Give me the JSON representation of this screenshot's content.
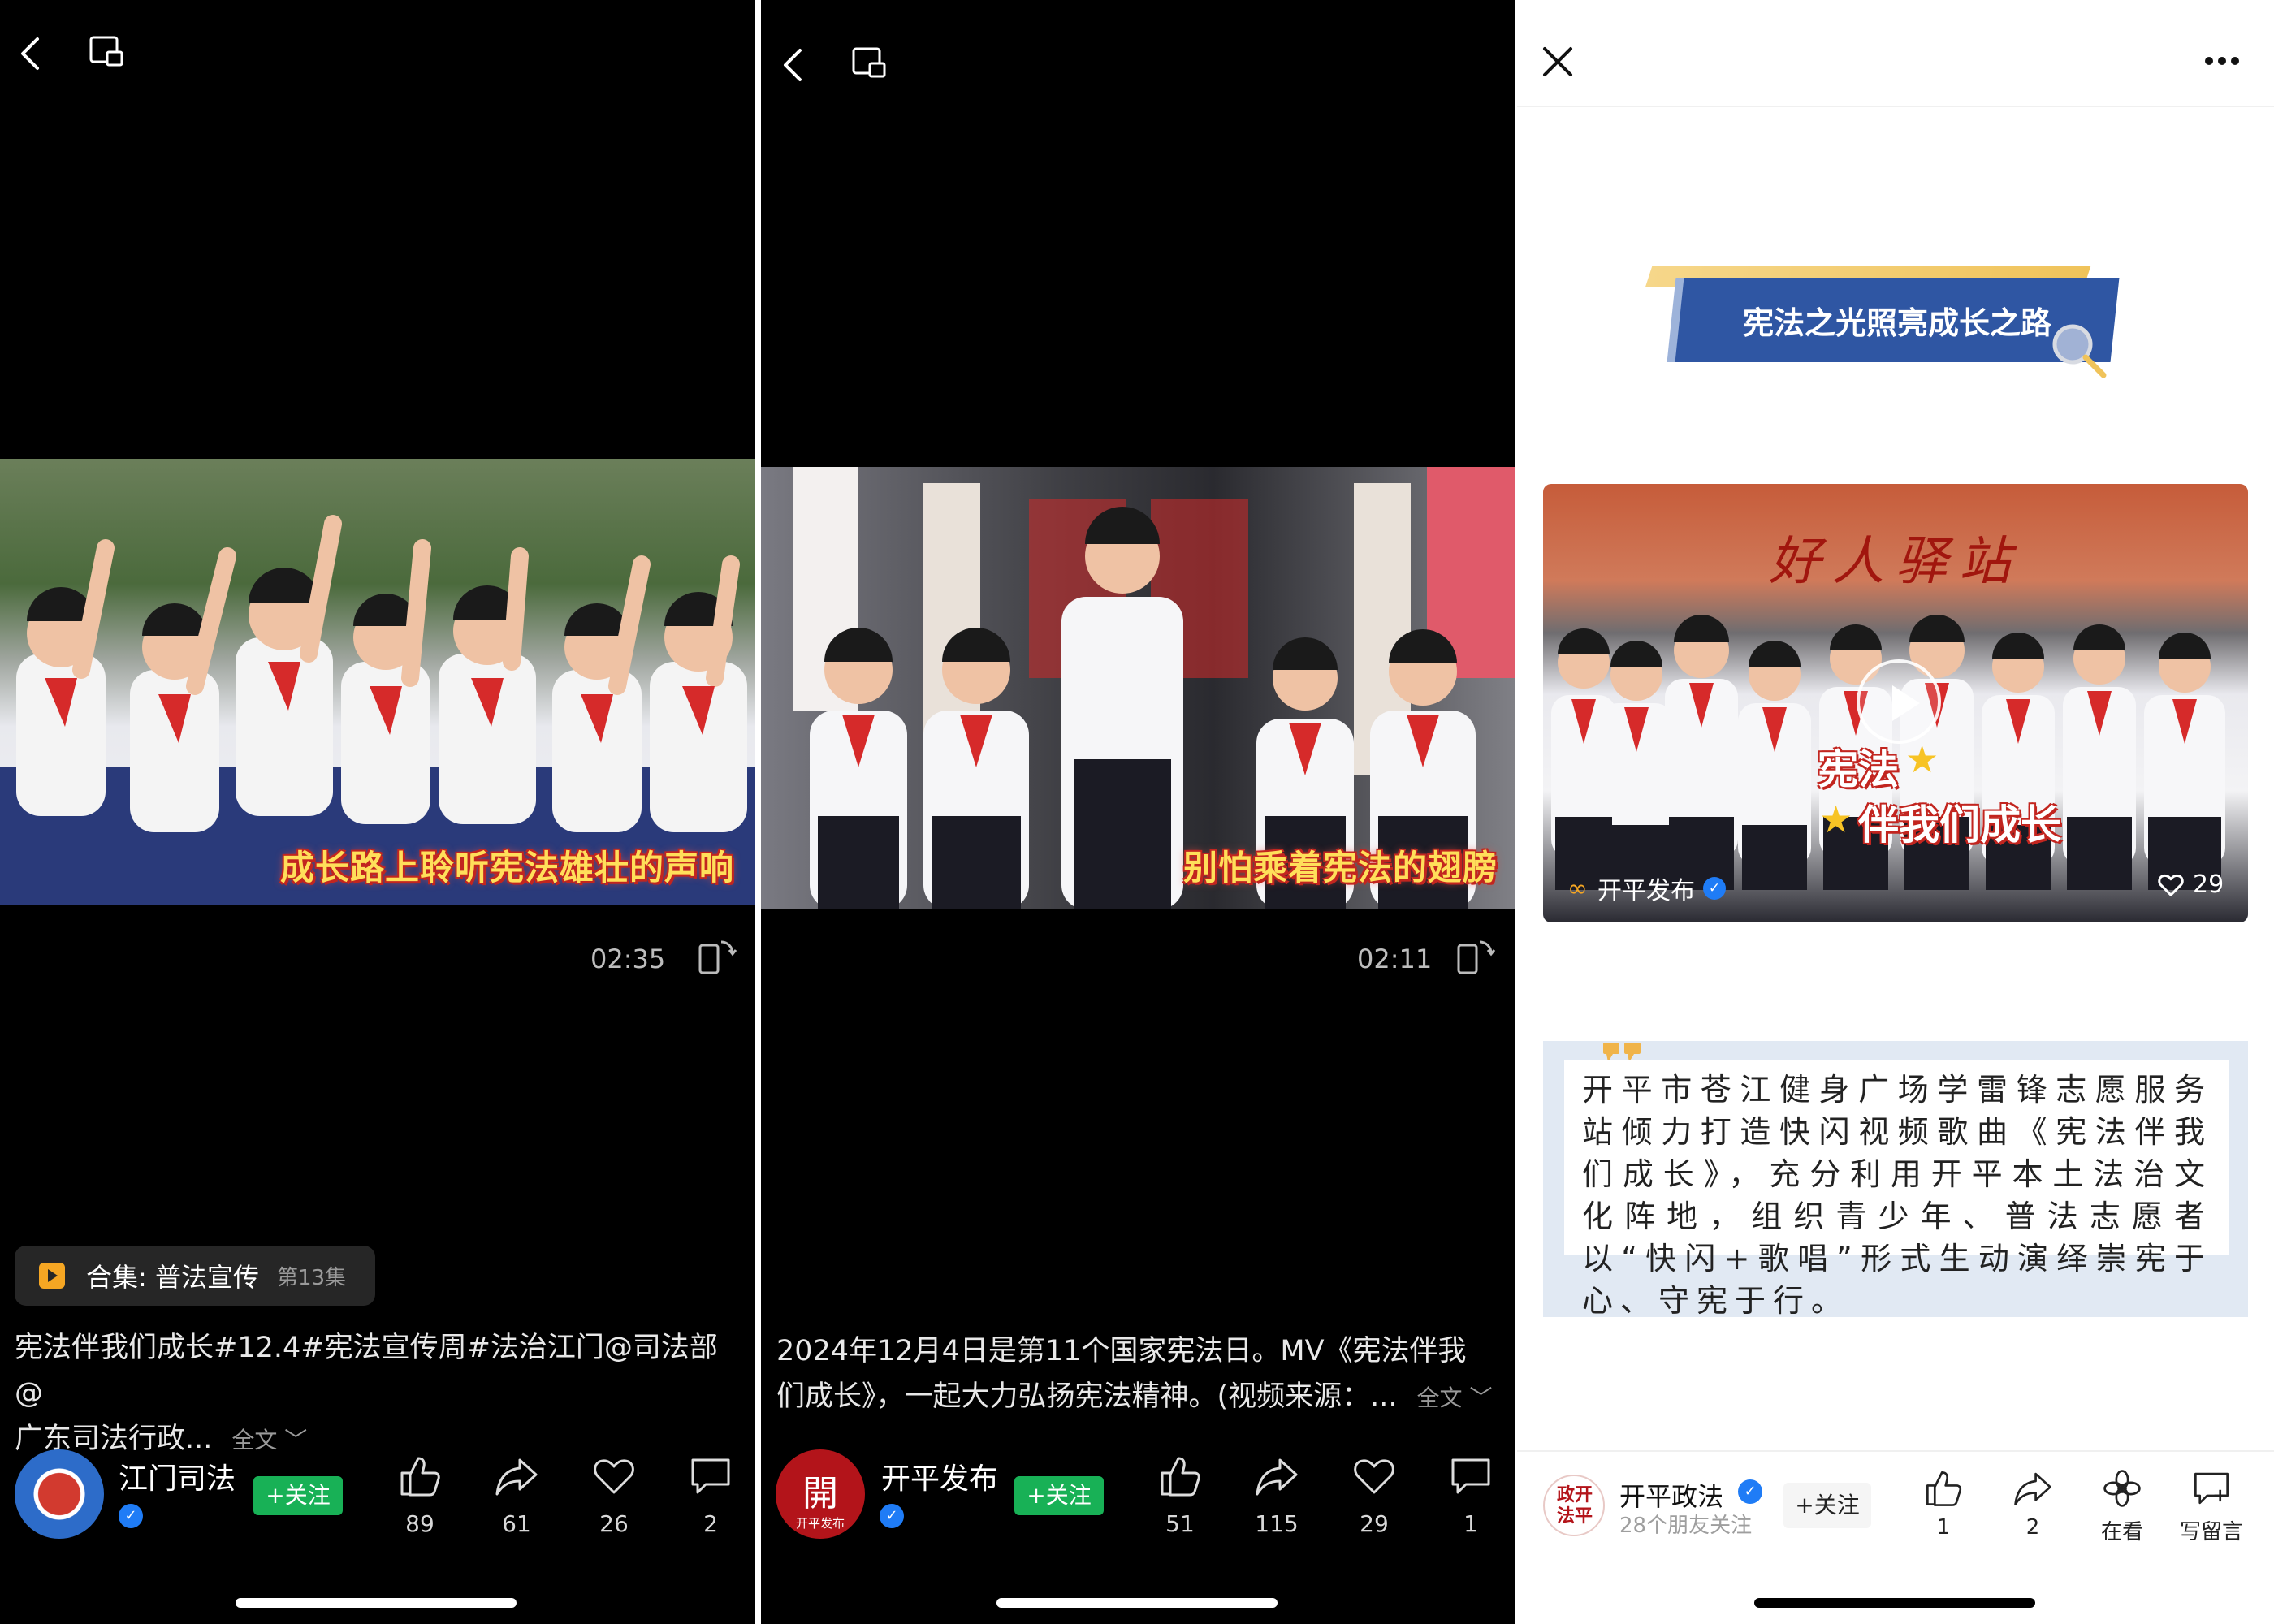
{
  "panel1": {
    "duration": "02:35",
    "subtitle": "成长路上聆听宪法雄壮的声响",
    "collection": {
      "label": "合集: 普法宣传",
      "episode": "第13集"
    },
    "caption_line1": "宪法伴我们成长#12.4#宪法宣传周#法治江门@司法部@",
    "caption_line2": "广东司法行政...",
    "more": "全文 ﹀",
    "account": "江门司法",
    "follow": "+关注",
    "stats": {
      "likes": "89",
      "shares": "61",
      "favorites": "26",
      "comments": "2"
    }
  },
  "panel2": {
    "duration": "02:11",
    "subtitle": "别怕乘着宪法的翅膀",
    "caption_line1": "2024年12月4日是第11个国家宪法日。MV《宪法伴我",
    "caption_line2": "们成长》，一起大力弘扬宪法精神。(视频来源：...",
    "more": "全文 ﹀",
    "account": "开平发布",
    "avatar_glyph": "開",
    "avatar_text": "开平发布",
    "follow": "+关注",
    "stats": {
      "likes": "51",
      "shares": "115",
      "favorites": "29",
      "comments": "1"
    }
  },
  "panel3": {
    "banner": "宪法之光照亮成长之路",
    "video": {
      "sign": "好人驿站",
      "title1": "宪法",
      "title2": "伴我们成长",
      "source": "开平发布",
      "likes": "29"
    },
    "quote": "开平市苍江健身广场学雷锋志愿服务站倾力打造快闪视频歌曲《宪法伴我们成长》，充分利用开平本土法治文化阵地，组织青少年、普法志愿者以“快闪+歌唱”形式生动演绎崇宪于心、守宪于行。",
    "account": "开平政法",
    "avatar_seal": "政开法平",
    "followers": "28个朋友关注",
    "follow": "+关注",
    "actions": {
      "likes": "1",
      "shares": "2",
      "watching": "在看",
      "comment": "写留言"
    }
  },
  "colors": {
    "follow_green": "#18b156",
    "verified_blue": "#1f7cf6",
    "banner_blue": "#2f56a3",
    "subtitle_yellow": "#ffdf5a"
  }
}
